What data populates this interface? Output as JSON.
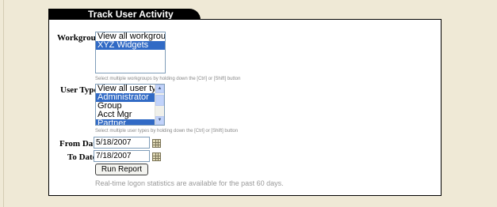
{
  "panel": {
    "title": "Track User Activity"
  },
  "workgroup": {
    "label": "Workgroup",
    "options": [
      {
        "text": "View all workgroups",
        "selected": false
      },
      {
        "text": "XYZ Widgets",
        "selected": true
      }
    ],
    "hint": "Select multiple workgroups by holding down the [Ctrl] or [Shift] button"
  },
  "user_type": {
    "label": "User Type",
    "options": [
      {
        "text": "View all user types",
        "selected": false
      },
      {
        "text": "Administrator",
        "selected": true
      },
      {
        "text": "Group",
        "selected": false
      },
      {
        "text": "Acct Mgr",
        "selected": false
      },
      {
        "text": "Partner",
        "selected": true
      }
    ],
    "hint": "Select multiple user types by holding down the [Ctrl] or [Shift] button"
  },
  "from_date": {
    "label": "From Date",
    "value": "5/18/2007"
  },
  "to_date": {
    "label": "To Date",
    "value": "7/18/2007"
  },
  "run_button": {
    "label": "Run Report"
  },
  "note": "Real-time logon statistics are available for the past 60 days.",
  "colors": {
    "selected_bg": "#316ac5",
    "page_bg": "#efe9d6",
    "tab_bg": "#000000"
  }
}
